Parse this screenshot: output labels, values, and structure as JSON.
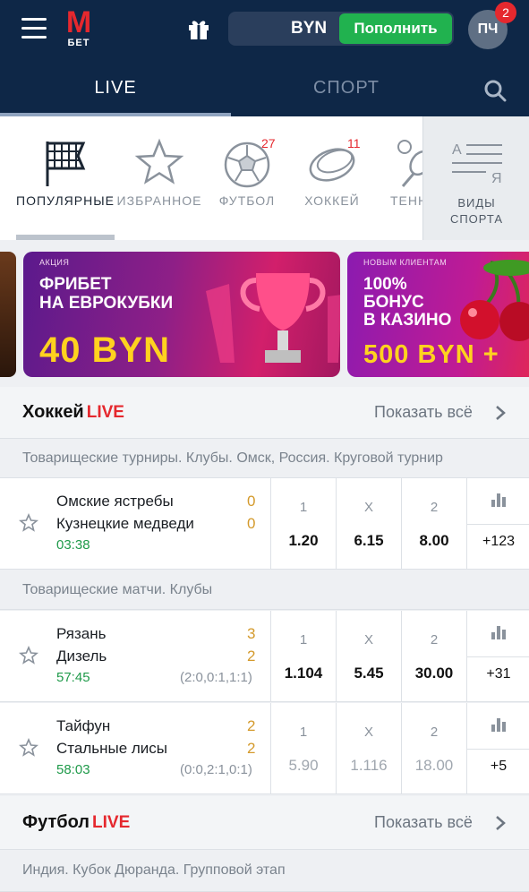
{
  "brand": {
    "logo_letter": "М",
    "logo_sub": "БЕТ",
    "accent": "#e5282e",
    "header_bg": "#0e2747"
  },
  "top": {
    "currency": "BYN",
    "topup_label": "Пополнить",
    "avatar_initials": "ПЧ",
    "notifications": "2"
  },
  "tabs": {
    "live": "LIVE",
    "sport": "СПОРТ"
  },
  "categories": [
    {
      "label": "ПОПУЛЯРНЫЕ",
      "icon": "flag-icon",
      "count": ""
    },
    {
      "label": "ИЗБРАННОЕ",
      "icon": "star-icon",
      "count": ""
    },
    {
      "label": "ФУТБОЛ",
      "icon": "football-icon",
      "count": "27"
    },
    {
      "label": "ХОККЕЙ",
      "icon": "puck-icon",
      "count": "11"
    },
    {
      "label": "ТЕНН",
      "icon": "tennis-icon",
      "count": ""
    }
  ],
  "sports_button": {
    "line1": "ВИДЫ",
    "line2": "СПОРТА",
    "icon": "list-icon"
  },
  "banners": [
    {
      "tag": "АКЦИЯ",
      "title1": "ФРИБЕТ",
      "title2": "НА ЕВРОКУБКИ",
      "amount": "40 BYN"
    },
    {
      "tag": "НОВЫМ КЛИЕНТАМ",
      "title1": "100%",
      "title2": "БОНУС",
      "title3": "В КАЗИНО",
      "amount": "500 BYN +"
    }
  ],
  "hockey": {
    "title": "Хоккей",
    "live": "LIVE",
    "show_all": "Показать всё",
    "leagues": [
      {
        "name": "Товарищеские турниры. Клубы. Омск, Россия. Круговой турнир",
        "events": [
          {
            "team1": "Омские ястребы",
            "team2": "Кузнецкие медведи",
            "score1": "0",
            "score2": "0",
            "time": "03:38",
            "sets": "",
            "k1": "1",
            "kx": "X",
            "k2": "2",
            "o1": "1.20",
            "ox": "6.15",
            "o2": "8.00",
            "more": "+123"
          }
        ]
      },
      {
        "name": "Товарищеские матчи. Клубы",
        "events": [
          {
            "team1": "Рязань",
            "team2": "Дизель",
            "score1": "3",
            "score2": "2",
            "time": "57:45",
            "sets": "(2:0,0:1,1:1)",
            "k1": "1",
            "kx": "X",
            "k2": "2",
            "o1": "1.104",
            "ox": "5.45",
            "o2": "30.00",
            "more": "+31"
          },
          {
            "team1": "Тайфун",
            "team2": "Стальные лисы",
            "score1": "2",
            "score2": "2",
            "time": "58:03",
            "sets": "(0:0,2:1,0:1)",
            "k1": "1",
            "kx": "X",
            "k2": "2",
            "o1": "5.90",
            "ox": "1.116",
            "o2": "18.00",
            "more": "+5"
          }
        ]
      }
    ]
  },
  "football": {
    "title": "Футбол",
    "live": "LIVE",
    "show_all": "Показать всё",
    "league": "Индия. Кубок Дюранда. Групповой этап"
  }
}
